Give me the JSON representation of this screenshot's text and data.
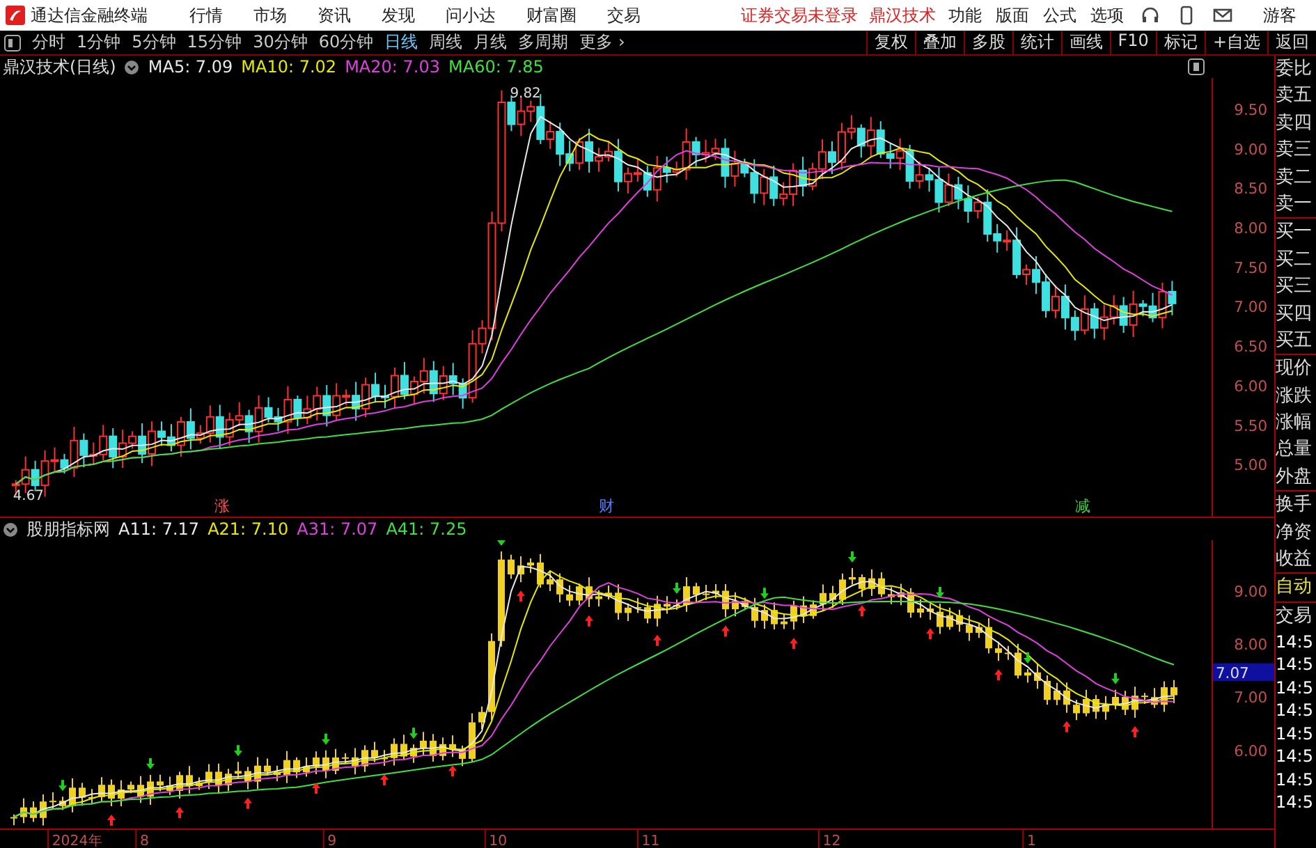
{
  "app": {
    "title": "通达信金融终端",
    "menu": [
      "行情",
      "市场",
      "资讯",
      "发现",
      "问小达",
      "财富圈",
      "交易"
    ],
    "notice": "证券交易未登录",
    "stock": "鼎汉技术",
    "tools": [
      "功能",
      "版面",
      "公式",
      "选项"
    ],
    "user": "游客"
  },
  "toolbar": {
    "periods": [
      {
        "label": "分时",
        "selected": false
      },
      {
        "label": "1分钟",
        "selected": false
      },
      {
        "label": "5分钟",
        "selected": false
      },
      {
        "label": "15分钟",
        "selected": false
      },
      {
        "label": "30分钟",
        "selected": false
      },
      {
        "label": "60分钟",
        "selected": false
      },
      {
        "label": "日线",
        "selected": true
      },
      {
        "label": "周线",
        "selected": false
      },
      {
        "label": "月线",
        "selected": false
      },
      {
        "label": "多周期",
        "selected": false
      }
    ],
    "more": "更多",
    "more_icon": "›",
    "actions": [
      "复权",
      "叠加",
      "多股",
      "统计",
      "画线",
      "F10",
      "标记",
      "+自选",
      "返回"
    ]
  },
  "price_pane": {
    "title": "鼎汉技术(日线)",
    "indicators": [
      {
        "label": "MA5: 7.09",
        "color": "#e8e8e8"
      },
      {
        "label": "MA10: 7.02",
        "color": "#e8e800"
      },
      {
        "label": "MA20: 7.03",
        "color": "#e040e0"
      },
      {
        "label": "MA60: 7.85",
        "color": "#40e040"
      }
    ],
    "high_label": "9.82",
    "low_label": "4.67",
    "axis": [
      "9.50",
      "9.00",
      "8.50",
      "8.00",
      "7.50",
      "7.00",
      "6.50",
      "6.00",
      "5.50",
      "5.00"
    ],
    "events": [
      {
        "label": "涨",
        "color": "#ff5050"
      },
      {
        "label": "财",
        "color": "#5080ff"
      },
      {
        "label": "减",
        "color": "#40d040"
      }
    ]
  },
  "indicator_pane": {
    "title": "股朋指标网",
    "indicators": [
      {
        "label": "A11: 7.17",
        "color": "#e8e8e8"
      },
      {
        "label": "A21: 7.10",
        "color": "#e8e800"
      },
      {
        "label": "A31: 7.07",
        "color": "#e040e0"
      },
      {
        "label": "A41: 7.25",
        "color": "#40e040"
      }
    ],
    "axis": [
      "9.00",
      "8.00",
      "7.00",
      "6.00"
    ],
    "current": "7.07"
  },
  "date_axis": [
    "2024年",
    "8",
    "9",
    "10",
    "11",
    "12",
    "1"
  ],
  "quote_panel": {
    "labels": [
      "委比",
      "卖五",
      "卖四",
      "卖三",
      "卖二",
      "卖一",
      "买一",
      "买二",
      "买三",
      "买四",
      "买五",
      "现价",
      "涨跌",
      "涨幅",
      "总量",
      "外盘",
      "换手",
      "净资",
      "收益"
    ],
    "mode": "自动",
    "trade": "交易",
    "times": [
      "14:5",
      "14:5",
      "14:5",
      "14:5",
      "14:5",
      "14:5",
      "14:5",
      "14:5"
    ]
  }
}
